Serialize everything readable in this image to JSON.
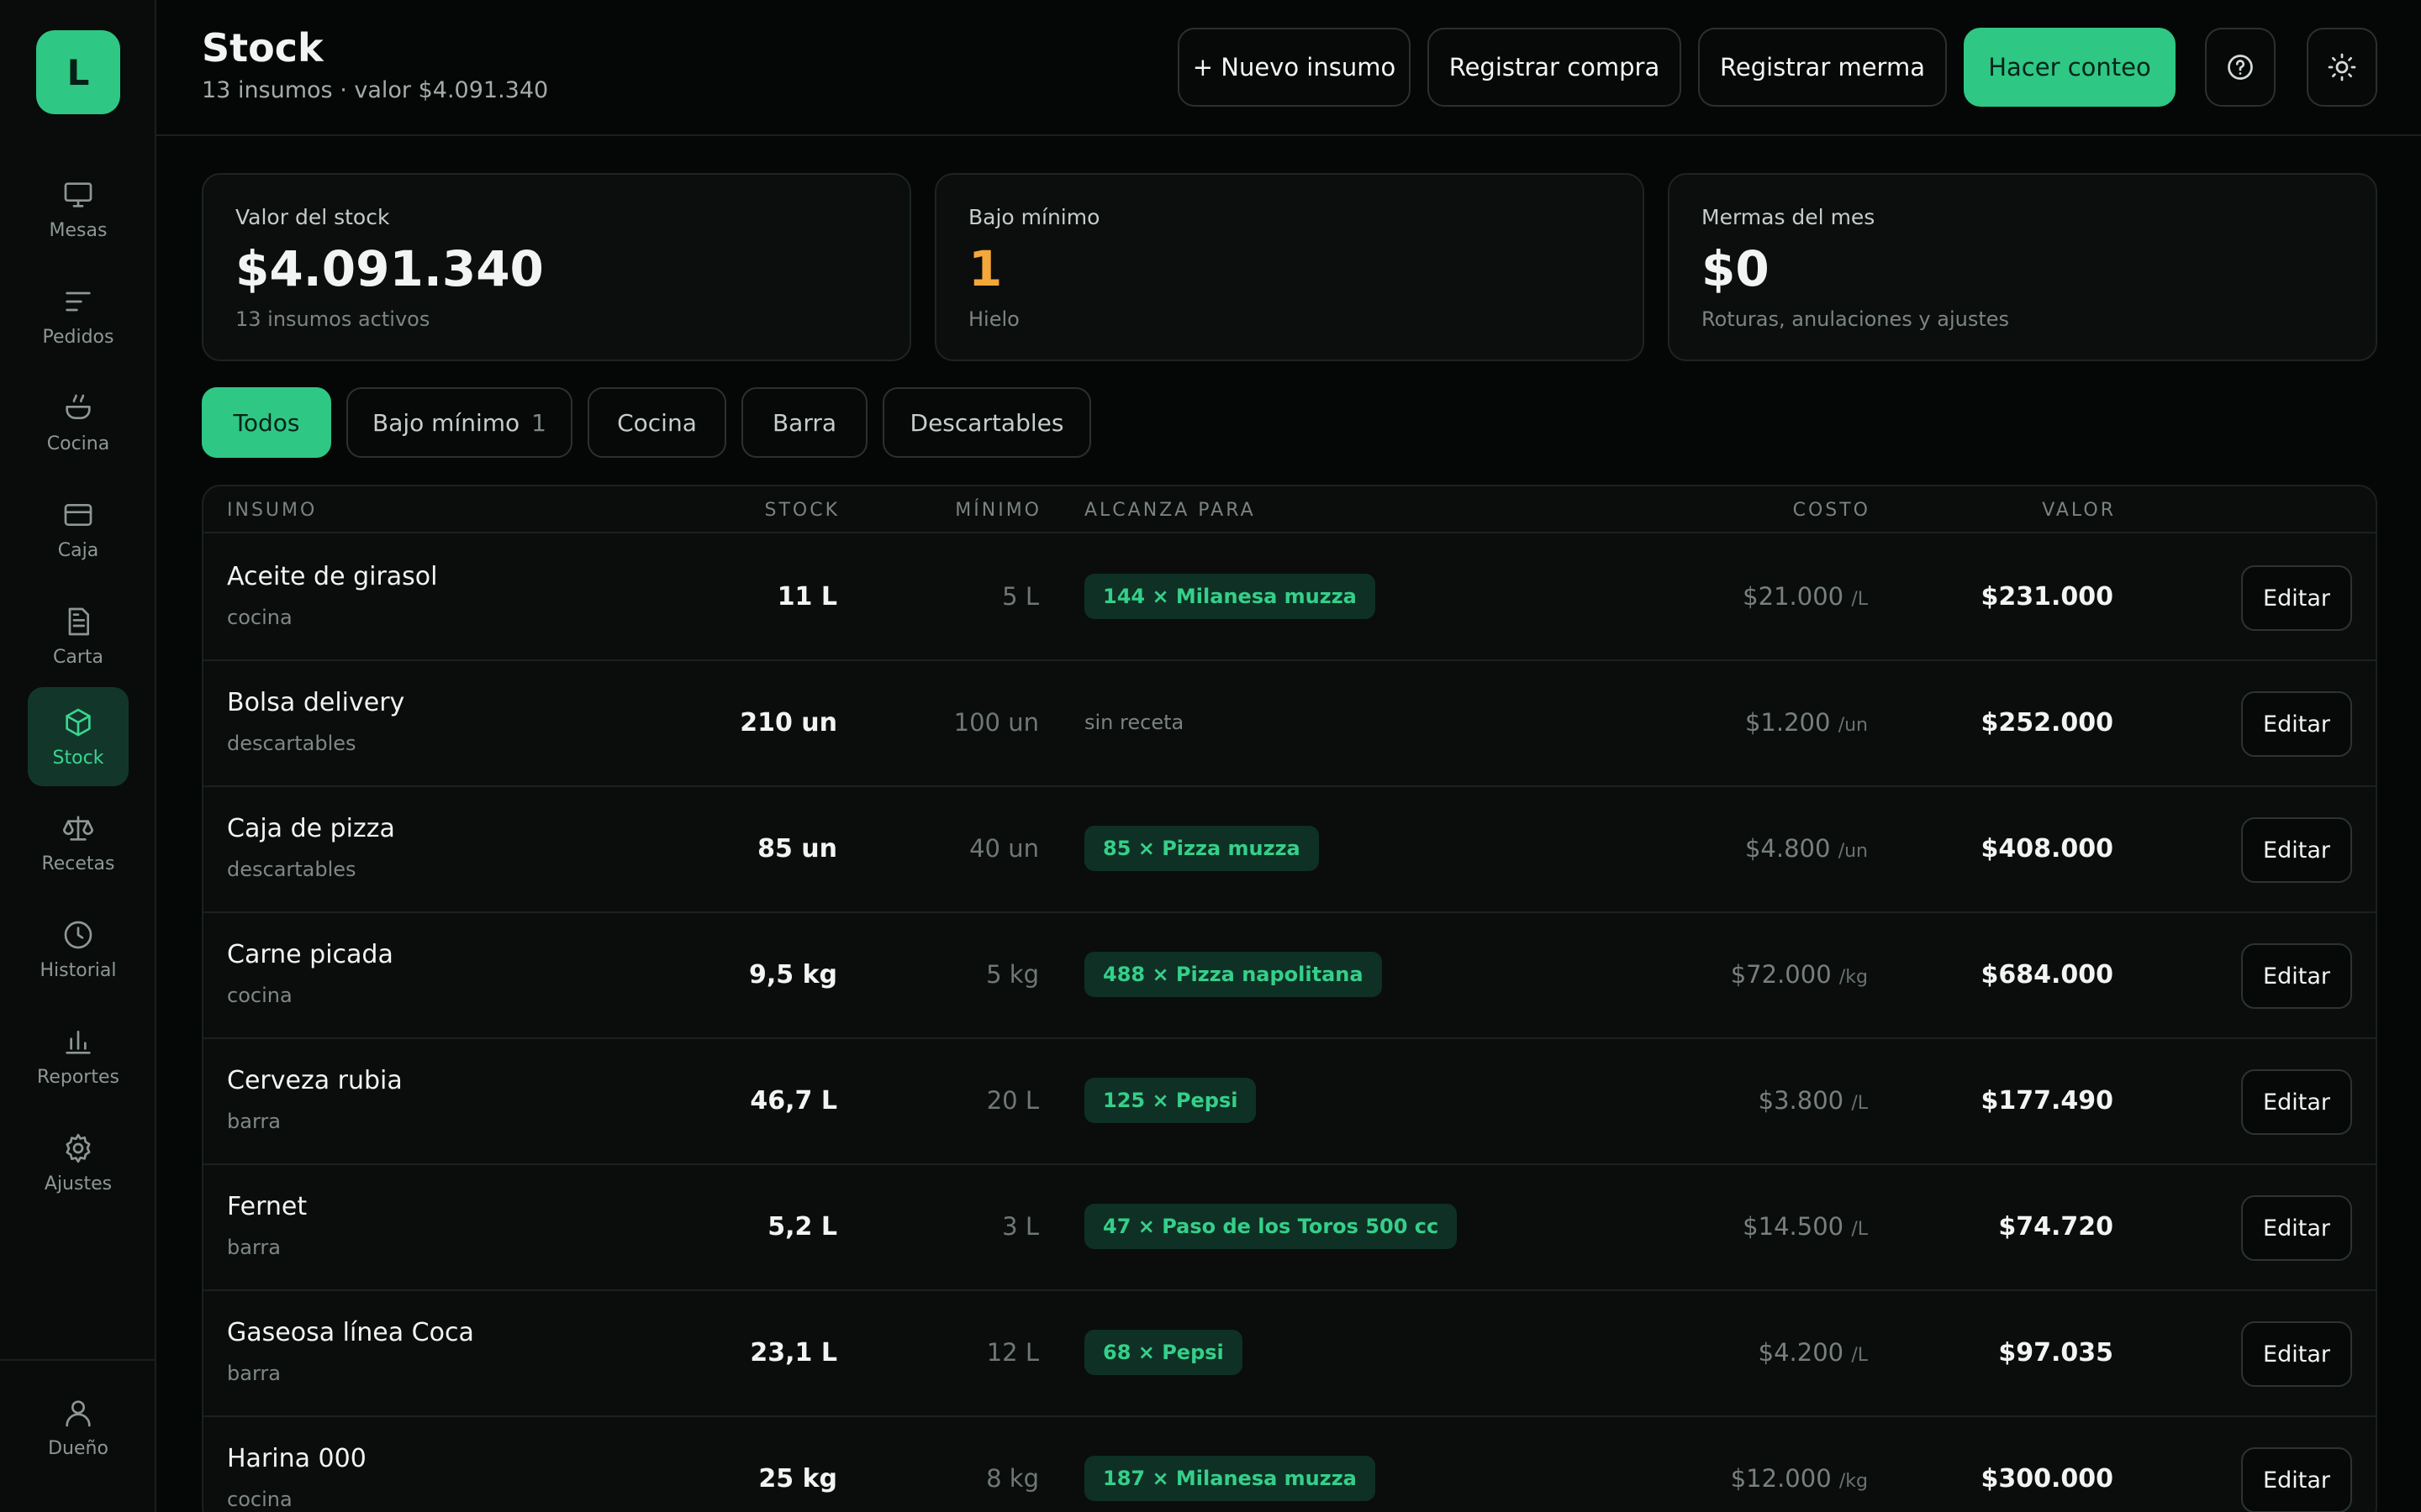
{
  "sidebar": {
    "logo_letter": "L",
    "items": [
      {
        "label": "Mesas",
        "icon": "monitor-icon"
      },
      {
        "label": "Pedidos",
        "icon": "lines-icon"
      },
      {
        "label": "Cocina",
        "icon": "pot-icon"
      },
      {
        "label": "Caja",
        "icon": "card-icon"
      },
      {
        "label": "Carta",
        "icon": "document-icon"
      },
      {
        "label": "Stock",
        "icon": "box-icon",
        "active": true
      },
      {
        "label": "Recetas",
        "icon": "scale-icon"
      },
      {
        "label": "Historial",
        "icon": "clock-icon"
      },
      {
        "label": "Reportes",
        "icon": "bar-chart-icon"
      },
      {
        "label": "Ajustes",
        "icon": "gear-icon"
      }
    ],
    "user": {
      "label": "Dueño",
      "icon": "user-icon"
    }
  },
  "header": {
    "title": "Stock",
    "subtitle": "13 insumos · valor $4.091.340",
    "buttons": {
      "new_item": "+ Nuevo insumo",
      "purchase": "Registrar compra",
      "waste": "Registrar merma",
      "count": "Hacer conteo"
    }
  },
  "cards": [
    {
      "label": "Valor del stock",
      "value": "$4.091.340",
      "note": "13 insumos activos"
    },
    {
      "label": "Bajo mínimo",
      "value": "1",
      "note": "Hielo"
    },
    {
      "label": "Mermas del mes",
      "value": "$0",
      "note": "Roturas, anulaciones y ajustes"
    }
  ],
  "filters": [
    {
      "label": "Todos",
      "active": true
    },
    {
      "label": "Bajo mínimo",
      "count": "1"
    },
    {
      "label": "Cocina"
    },
    {
      "label": "Barra"
    },
    {
      "label": "Descartables"
    }
  ],
  "table": {
    "headers": {
      "item": "INSUMO",
      "stock": "STOCK",
      "min": "MÍNIMO",
      "reach": "ALCANZA PARA",
      "cost": "COSTO",
      "value": "VALOR"
    },
    "edit_label": "Editar",
    "rows": [
      {
        "name": "Aceite de girasol",
        "cat": "cocina",
        "stock": "11 L",
        "min": "5 L",
        "reach": "144 × Milanesa muzza",
        "cost": "$21.000",
        "unit": "/L",
        "value": "$231.000"
      },
      {
        "name": "Bolsa delivery",
        "cat": "descartables",
        "stock": "210 un",
        "min": "100 un",
        "reach": "sin receta",
        "reach_plain": true,
        "cost": "$1.200",
        "unit": "/un",
        "value": "$252.000"
      },
      {
        "name": "Caja de pizza",
        "cat": "descartables",
        "stock": "85 un",
        "min": "40 un",
        "reach": "85 × Pizza muzza",
        "cost": "$4.800",
        "unit": "/un",
        "value": "$408.000"
      },
      {
        "name": "Carne picada",
        "cat": "cocina",
        "stock": "9,5 kg",
        "min": "5 kg",
        "reach": "488 × Pizza napolitana",
        "cost": "$72.000",
        "unit": "/kg",
        "value": "$684.000"
      },
      {
        "name": "Cerveza rubia",
        "cat": "barra",
        "stock": "46,7 L",
        "min": "20 L",
        "reach": "125 × Pepsi",
        "cost": "$3.800",
        "unit": "/L",
        "value": "$177.490"
      },
      {
        "name": "Fernet",
        "cat": "barra",
        "stock": "5,2 L",
        "min": "3 L",
        "reach": "47 × Paso de los Toros 500 cc",
        "cost": "$14.500",
        "unit": "/L",
        "value": "$74.720"
      },
      {
        "name": "Gaseosa línea Coca",
        "cat": "barra",
        "stock": "23,1 L",
        "min": "12 L",
        "reach": "68 × Pepsi",
        "cost": "$4.200",
        "unit": "/L",
        "value": "$97.035"
      },
      {
        "name": "Harina 000",
        "cat": "cocina",
        "stock": "25 kg",
        "min": "8 kg",
        "reach": "187 × Milanesa muzza",
        "cost": "$12.000",
        "unit": "/kg",
        "value": "$300.000"
      }
    ]
  }
}
